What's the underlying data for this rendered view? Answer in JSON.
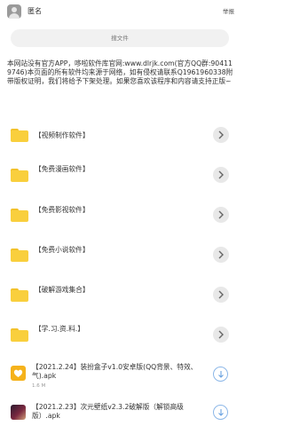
{
  "header": {
    "username": "匿名",
    "right_label": "举报"
  },
  "search": {
    "placeholder": "搜文件"
  },
  "notice": "本网站没有官方APP，哆啦软件库官网:www.dlrjk.com(官方QQ群:904119746)本页面的所有软件均来源于网络，如有侵权请联系Q1961960338附带版权证明，我们将给予下架处理。如果您喜欢该程序和内容请支持正版~",
  "folders": [
    {
      "label": "【视频制作软件】",
      "icon": "folder-icon"
    },
    {
      "label": "【免费漫画软件】",
      "icon": "folder-icon"
    },
    {
      "label": "【免费影视软件】",
      "icon": "folder-icon"
    },
    {
      "label": "【免费小说软件】",
      "icon": "folder-icon"
    },
    {
      "label": "【破解游戏集合】",
      "icon": "folder-icon"
    },
    {
      "label": "【学.习.资.料.】",
      "icon": "folder-icon"
    }
  ],
  "files": [
    {
      "name": "【2021.2.24】装扮盒子v1.0安卓版(QQ背景、特效、气).apk",
      "size": "1.6 M",
      "icon": "heart-app-icon"
    },
    {
      "name": "【2021.2.23】次元壁纸v2.3.2破解版（解锁高级版）.apk",
      "size": "",
      "icon": "anime-app-icon"
    }
  ],
  "colors": {
    "folder": "#f9cf3d",
    "download_ring": "#8cb7e8"
  }
}
